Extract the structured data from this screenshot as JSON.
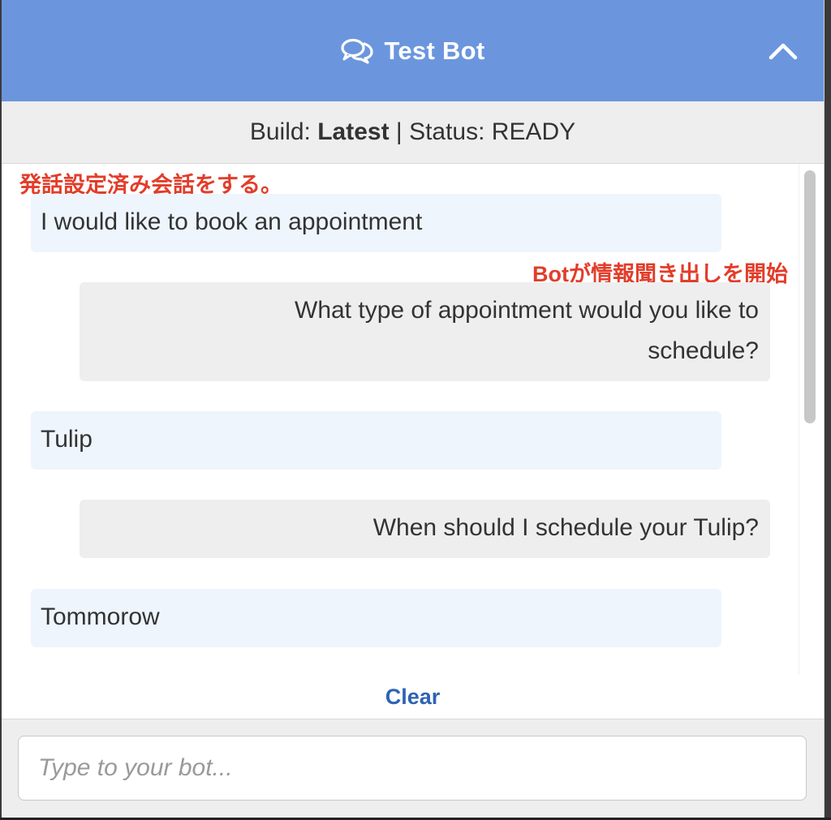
{
  "header": {
    "title": "Test Bot",
    "icon": "chat-bubbles-icon",
    "collapse_icon": "chevron-up-icon",
    "bg_color": "#6b96dd"
  },
  "status_bar": {
    "build_label": "Build:",
    "build_value": "Latest",
    "separator": "|",
    "status_label": "Status:",
    "status_value": "READY"
  },
  "annotations": {
    "utterance_note": "発話設定済み会話をする。",
    "bot_note": "Botが情報聞き出しを開始"
  },
  "messages": [
    {
      "sender": "user",
      "text": "I would like to book an appointment"
    },
    {
      "sender": "bot",
      "line1": "What type of appointment would you like to",
      "line2": "schedule?"
    },
    {
      "sender": "user",
      "text": "Tulip"
    },
    {
      "sender": "bot",
      "text": "When should I schedule your Tulip?"
    },
    {
      "sender": "user",
      "text": "Tommorow"
    }
  ],
  "clear_label": "Clear",
  "input": {
    "placeholder": "Type to your bot...",
    "value": ""
  },
  "colors": {
    "annotation": "#e23d2a",
    "link": "#2d63b4",
    "user_bubble": "#eef5fd",
    "bot_bubble": "#eeeeee"
  }
}
